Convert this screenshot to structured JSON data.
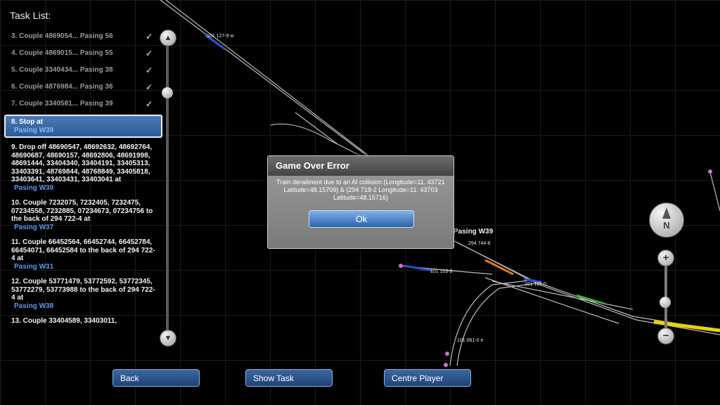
{
  "task_list": {
    "title": "Task List:",
    "completed": [
      {
        "label": "3. Couple 4869054... Pasing 56"
      },
      {
        "label": "4. Couple 4869015... Pasing 55"
      },
      {
        "label": "5. Couple 3340434... Pasing 38"
      },
      {
        "label": "6. Couple 4876984... Pasing 36"
      },
      {
        "label": "7. Couple 3340581... Pasing 39"
      }
    ],
    "check_glyph": "✓",
    "selected": {
      "label": "8. Stop at",
      "location": "Pasing W39"
    },
    "items": [
      {
        "label": "9. Drop off 48690547, 48692632, 48692764, 48690687, 48690157, 48692806, 48691998, 48691444, 33404340, 33404191, 33405313, 33403391, 48769844, 48768849, 33405818, 33403641, 33403431, 33403041 at",
        "location": "Pasing W39"
      },
      {
        "label": "10. Couple 7232075, 7232405, 7232475, 07234558, 7232885, 07234673, 07234756 to the back of 294 722-4 at",
        "location": "Pasing W37"
      },
      {
        "label": "11. Couple 66452564, 66452744, 66452784, 66454071, 66452584 to the back of 294 722-4 at",
        "location": "Pasing W31"
      },
      {
        "label": "12. Couple 53771479, 53772592, 53772345, 53772279, 53773988 to the back of 294 722-4 at",
        "location": "Pasing W38"
      },
      {
        "label": "13. Couple 33404589, 33403011,",
        "location": ""
      }
    ],
    "scroll_up_icon": "triangle-up",
    "scroll_down_icon": "triangle-down",
    "scroll_level": 0.18
  },
  "dialog": {
    "title": "Game Over Error",
    "message": "Train derailment due to an AI collision (Longitude=11. 43721 Latitude=48.15709) & (294 718-2 Longitude=11. 43703 Latitude=48.15716)",
    "ok_label": "Ok"
  },
  "buttons": {
    "back": "Back",
    "show_task": "Show Task",
    "centre_player": "Centre Player"
  },
  "map": {
    "labels": {
      "train_top": "101 127-9 w",
      "station": "Pasing W39",
      "train_a": "294 744-8",
      "train_b": "101 103-9",
      "train_c": "101 116-0",
      "train_d": "101 061-0 e"
    },
    "compass_letter": "N",
    "zoom_in": "+",
    "zoom_out": "−",
    "zoom_level": 0.5,
    "colors": {
      "track": "#bdbdbd",
      "highlight_yellow": "#e8d400",
      "highlight_orange": "#e07a1a",
      "highlight_green": "#38b030",
      "train_blue": "#2a4fd0",
      "marker_pink": "#d070d0"
    }
  }
}
